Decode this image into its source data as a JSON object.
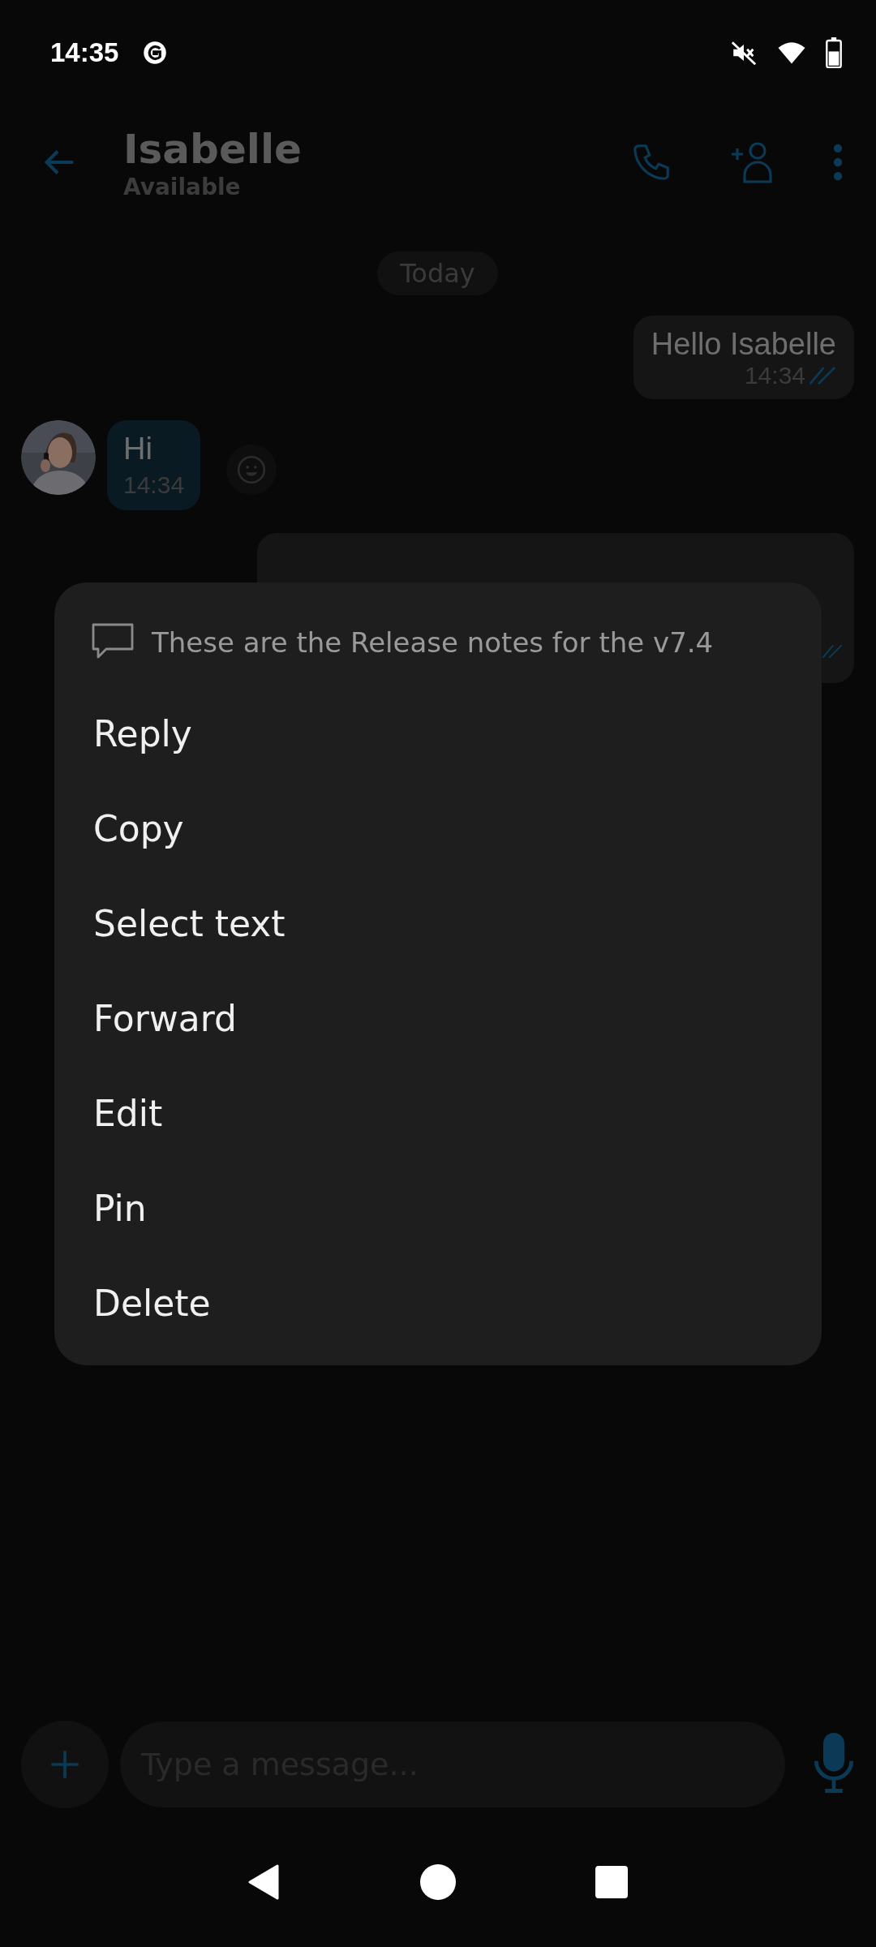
{
  "status_bar": {
    "time": "14:35"
  },
  "header": {
    "title": "Isabelle",
    "subtitle": "Available"
  },
  "date_chip": "Today",
  "messages": [
    {
      "kind": "outgoing",
      "text": "Hello Isabelle",
      "time": "14:34"
    },
    {
      "kind": "incoming",
      "text": "Hi",
      "time": "14:34"
    },
    {
      "kind": "covered"
    }
  ],
  "context_menu": {
    "preview": "These are the Release notes for the v7.4",
    "items": [
      "Reply",
      "Copy",
      "Select text",
      "Forward",
      "Edit",
      "Pin",
      "Delete"
    ]
  },
  "composer": {
    "placeholder": "Type a message..."
  }
}
